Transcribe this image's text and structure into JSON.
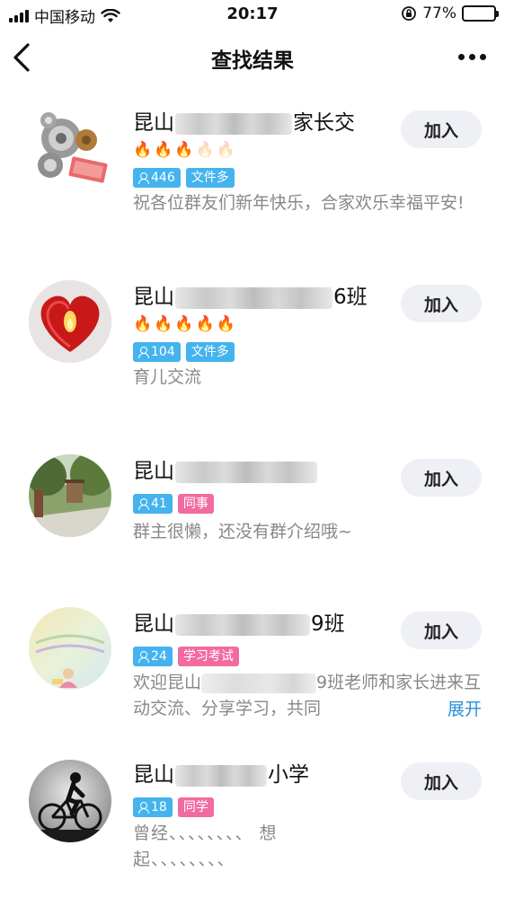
{
  "status_bar": {
    "carrier": "中国移动",
    "time": "20:17",
    "battery": "77%",
    "battery_level": 0.77
  },
  "nav": {
    "title": "查找结果"
  },
  "join_label": "加入",
  "expand_label": "展开",
  "results": [
    {
      "name_prefix": "昆山",
      "name_suffix": "家长交",
      "fire_level": 3,
      "fire_total": 5,
      "member_count": "446",
      "tags": [
        {
          "label": "文件多",
          "color": "#44b3ee"
        }
      ],
      "description": "祝各位群友们新年快乐，合家欢乐幸福平安!"
    },
    {
      "name_prefix": "昆山",
      "name_suffix": "6班",
      "fire_level": 5,
      "fire_total": 5,
      "member_count": "104",
      "tags": [
        {
          "label": "文件多",
          "color": "#44b3ee"
        }
      ],
      "description": "育儿交流"
    },
    {
      "name_prefix": "昆山",
      "name_suffix": "",
      "member_count": "41",
      "tags": [
        {
          "label": "同事",
          "color": "#f26ba0"
        }
      ],
      "description": "群主很懒，还没有群介绍哦~"
    },
    {
      "name_prefix": "昆山",
      "name_suffix": "9班",
      "member_count": "24",
      "tags": [
        {
          "label": "学习考试",
          "color": "#f26ba0"
        }
      ],
      "description_head": "欢迎昆山",
      "description_tail": "9班老师和家长进来互动交流、分享学习，共同"
    },
    {
      "name_prefix": "昆山",
      "name_suffix": "小学",
      "member_count": "18",
      "tags": [
        {
          "label": "同学",
          "color": "#f26ba0"
        }
      ],
      "description": "曾经、、、、、、、、 想起、、、、、、、、"
    }
  ]
}
